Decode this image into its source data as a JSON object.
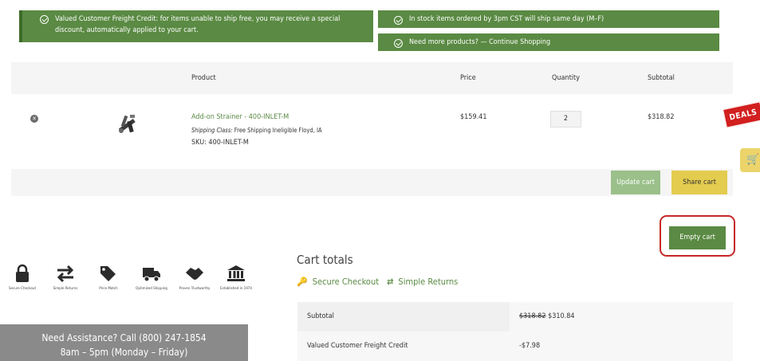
{
  "notices": {
    "freight_credit": "Valued Customer Freight Credit: for items unable to ship free, you may receive a special discount, automatically applied to your cart.",
    "same_day": "In stock items ordered by 3pm CST will ship same day (M–F)",
    "more_products": "Need more products? — Continue Shopping"
  },
  "cart": {
    "columns": {
      "product": "Product",
      "price": "Price",
      "quantity": "Quantity",
      "subtotal": "Subtotal"
    },
    "items": [
      {
        "name": "Add-on Strainer - 400-INLET-M",
        "shipping_class_label": "Shipping Class:",
        "shipping_class_value": "Free Shipping Ineligible Floyd, IA",
        "sku": "SKU: 400-INLET-M",
        "price": "$159.41",
        "quantity": "2",
        "subtotal": "$318.82"
      }
    ],
    "update_label": "Update cart",
    "share_label": "Share cart",
    "empty_label": "Empty cart"
  },
  "side_tabs": {
    "deals": "DEALS",
    "cart_icon": "cart-icon"
  },
  "trust_badges": [
    {
      "icon": "lock-icon",
      "label": "Secure Checkout"
    },
    {
      "icon": "arrows-swap-icon",
      "label": "Simple Returns"
    },
    {
      "icon": "tags-icon",
      "label": "Price Match"
    },
    {
      "icon": "truck-icon",
      "label": "Optimized Shipping"
    },
    {
      "icon": "handshake-icon",
      "label": "Proven Trustworthy"
    },
    {
      "icon": "bank-icon",
      "label": "Established in 1974"
    }
  ],
  "assist": {
    "line1": "Need Assistance? Call (800) 247-1854",
    "line2": "8am – 5pm (Monday – Friday)"
  },
  "totals": {
    "title": "Cart totals",
    "secure": "Secure Checkout",
    "returns": "Simple Returns",
    "rows": [
      {
        "label": "Subtotal",
        "old_value": "$318.82",
        "value": "$310.84"
      },
      {
        "label": "Valued Customer Freight Credit",
        "value": "-$7.98"
      }
    ]
  },
  "colors": {
    "green": "#5a8a43",
    "yellow": "#e4cc4e",
    "red": "#c62828",
    "light_green": "#9bc08a"
  }
}
